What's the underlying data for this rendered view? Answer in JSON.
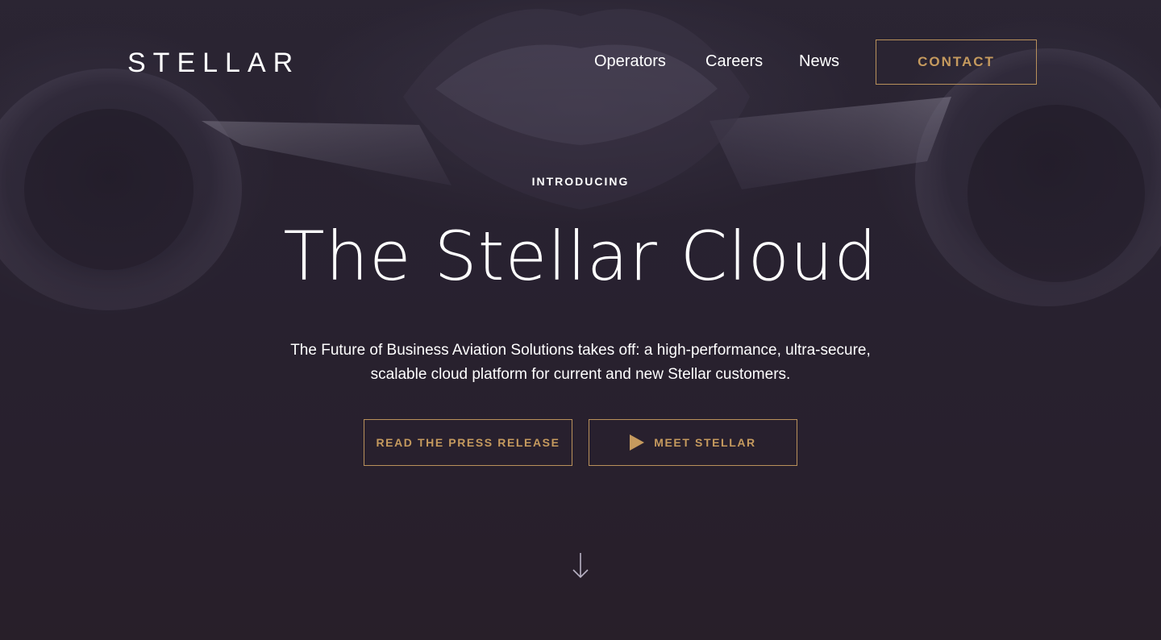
{
  "brand": {
    "logo_text": "STELLAR"
  },
  "nav": {
    "links": [
      {
        "label": "Operators"
      },
      {
        "label": "Careers"
      },
      {
        "label": "News"
      }
    ],
    "contact_label": "CONTACT"
  },
  "hero": {
    "eyebrow": "INTRODUCING",
    "title": "The Stellar Cloud",
    "subtitle_line1": "The Future of Business Aviation Solutions takes off: a high-performance, ultra-secure,",
    "subtitle_line2": "scalable cloud platform for current and new Stellar customers.",
    "cta_press": "READ THE PRESS RELEASE",
    "cta_meet": "MEET STELLAR"
  },
  "icons": {
    "play": "play-icon",
    "scroll": "arrow-down-icon"
  },
  "colors": {
    "accent_gold": "#c59a5e",
    "background": "#2a2433",
    "text": "#ffffff"
  }
}
